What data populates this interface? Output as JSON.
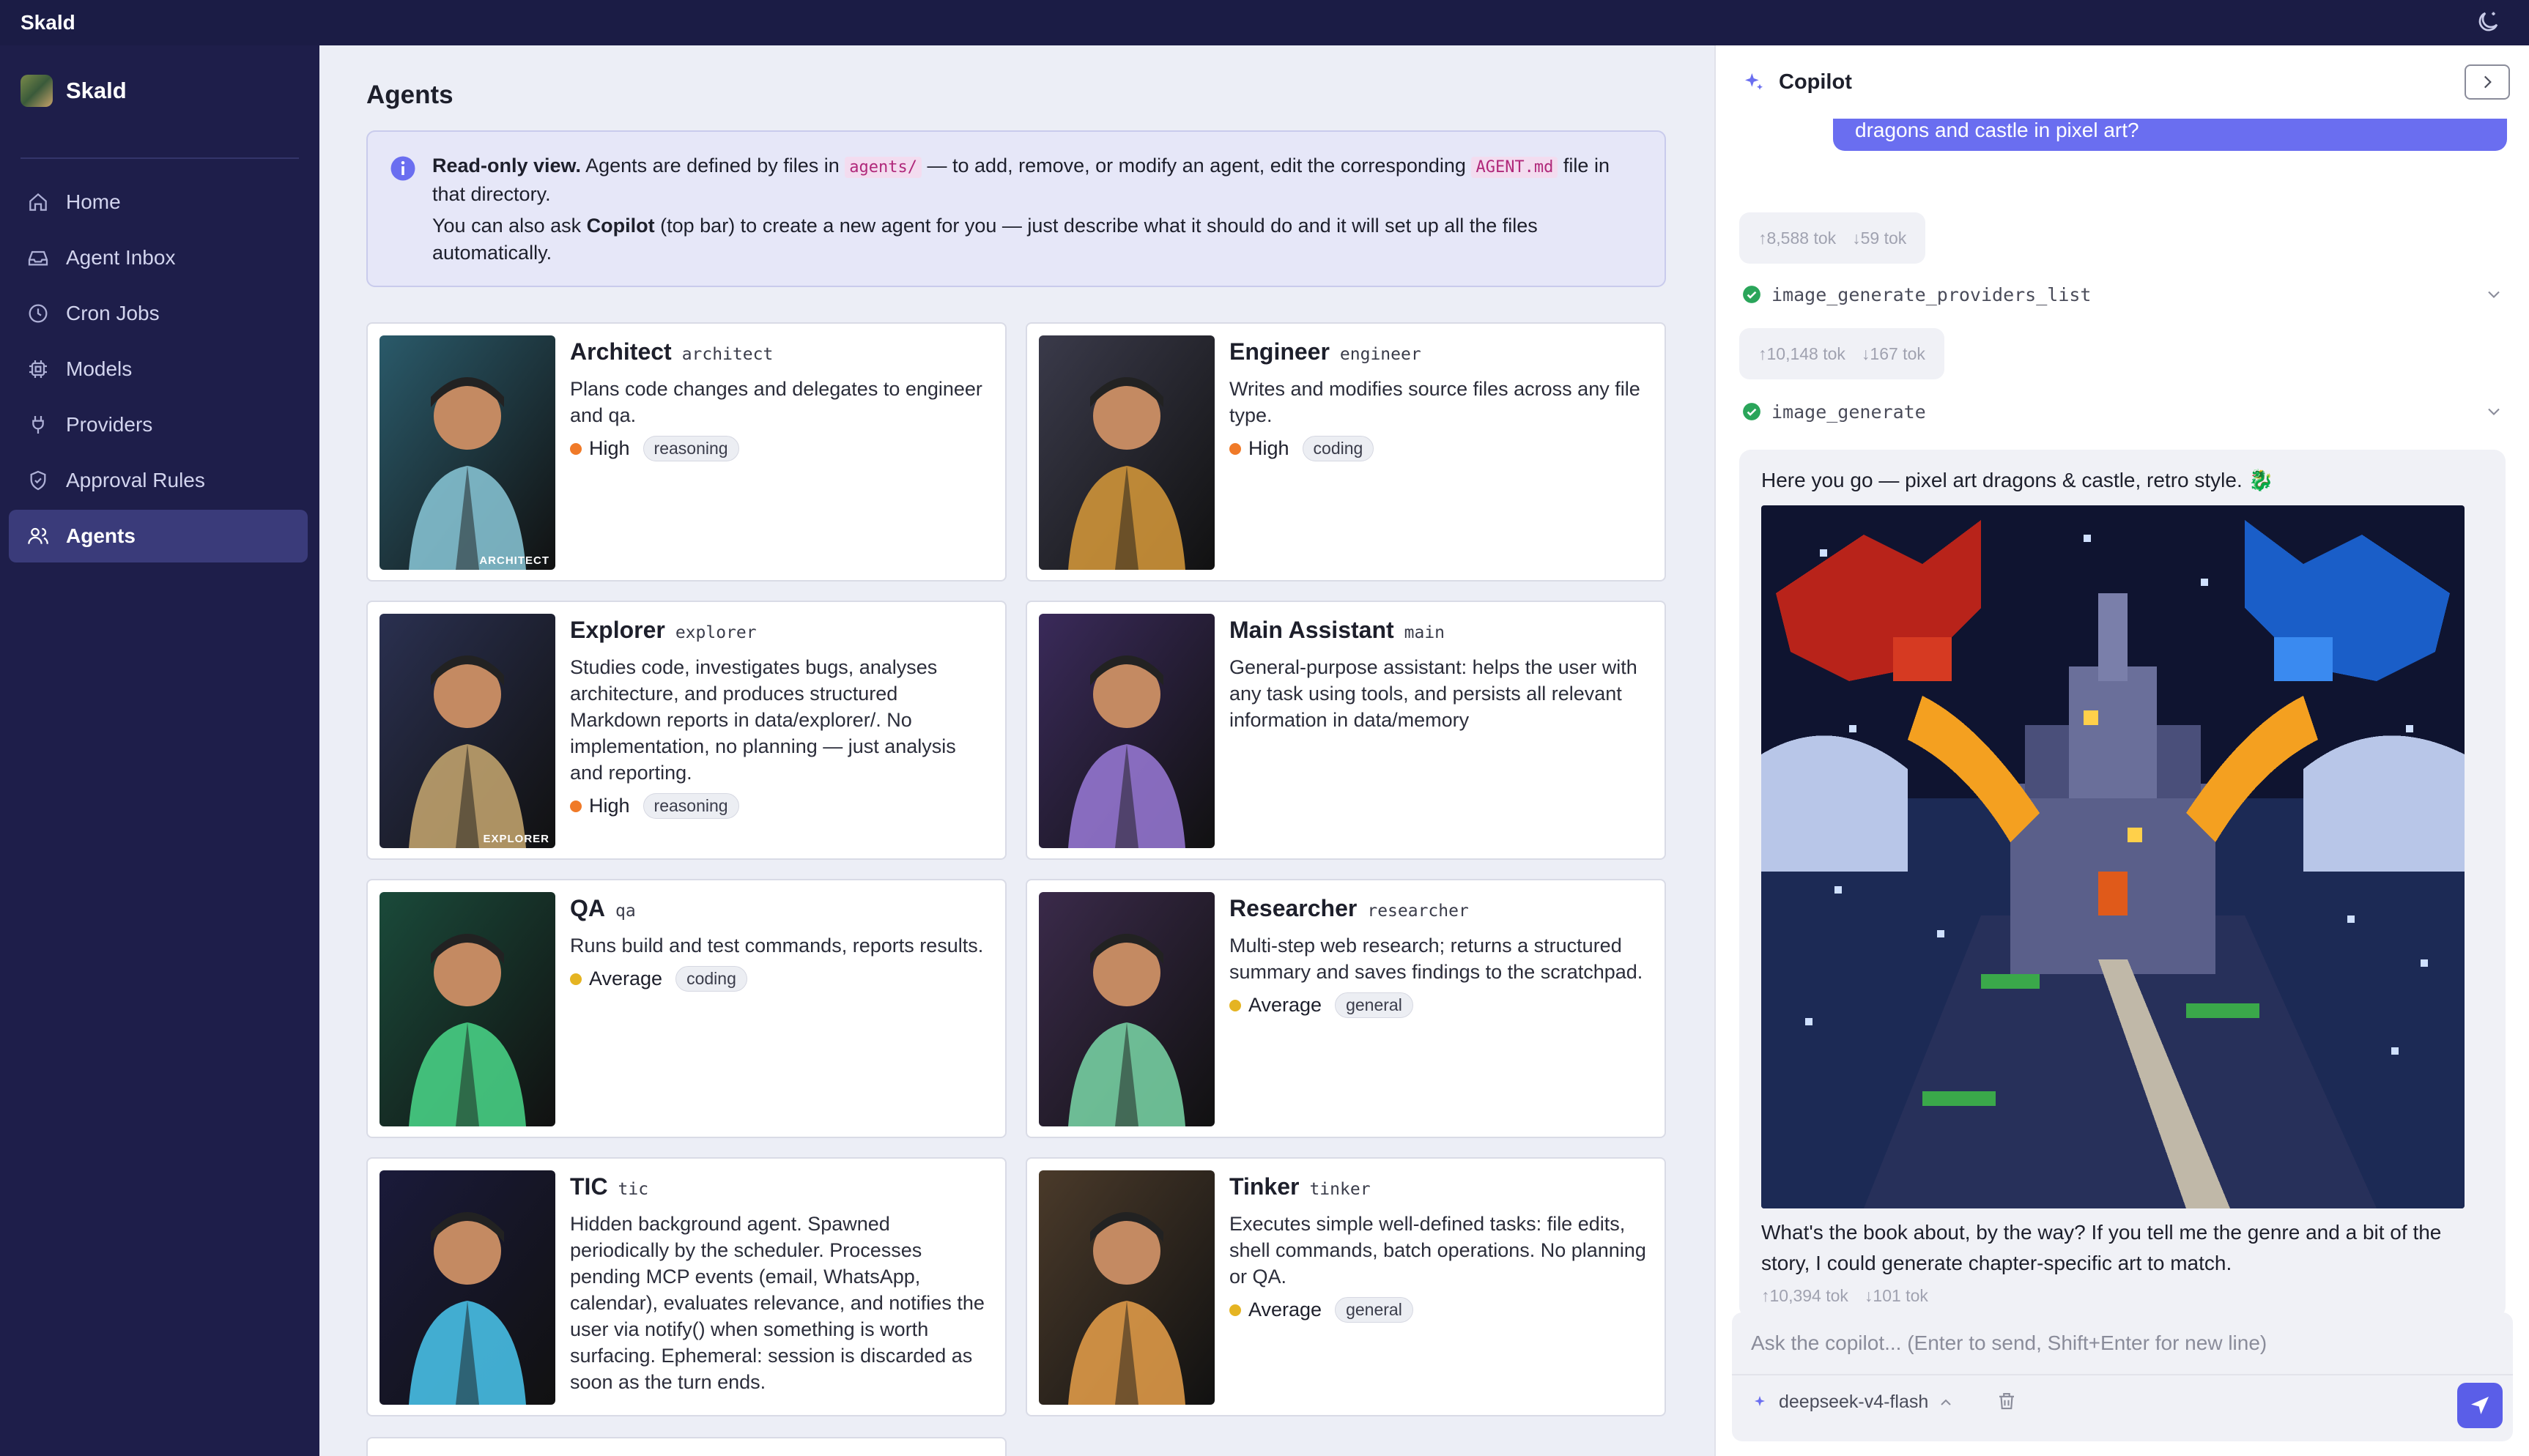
{
  "topbar": {
    "title": "Skald"
  },
  "sidebar": {
    "brand": "Skald",
    "items": [
      {
        "label": "Home",
        "icon": "home-icon"
      },
      {
        "label": "Agent Inbox",
        "icon": "inbox-icon"
      },
      {
        "label": "Cron Jobs",
        "icon": "clock-icon"
      },
      {
        "label": "Models",
        "icon": "chip-icon"
      },
      {
        "label": "Providers",
        "icon": "plug-icon"
      },
      {
        "label": "Approval Rules",
        "icon": "shield-icon"
      },
      {
        "label": "Agents",
        "icon": "users-icon",
        "active": true
      }
    ]
  },
  "main": {
    "title": "Agents",
    "notice": {
      "bold": "Read-only view.",
      "text1": " Agents are defined by files in ",
      "code1": "agents/",
      "text2": " — to add, remove, or modify an agent, edit the corresponding ",
      "code2": "AGENT.md",
      "text3": " file in that directory.",
      "line2a": "You can also ask ",
      "line2b": "Copilot",
      "line2c": " (top bar) to create a new agent for you — just describe what it should do and it will set up all the files automatically."
    },
    "agents": [
      {
        "name": "Architect",
        "id": "architect",
        "desc": "Plans code changes and delegates to engineer and qa.",
        "level": "High",
        "tag": "reasoning",
        "caption": "ARCHITECT"
      },
      {
        "name": "Engineer",
        "id": "engineer",
        "desc": "Writes and modifies source files across any file type.",
        "level": "High",
        "tag": "coding",
        "caption": ""
      },
      {
        "name": "Explorer",
        "id": "explorer",
        "desc": "Studies code, investigates bugs, analyses architecture, and produces structured Markdown reports in data/explorer/. No implementation, no planning — just analysis and reporting.",
        "level": "High",
        "tag": "reasoning",
        "caption": "EXPLORER"
      },
      {
        "name": "Main Assistant",
        "id": "main",
        "desc": "General-purpose assistant: helps the user with any task using tools, and persists all relevant information in data/memory",
        "level": "",
        "tag": "",
        "caption": ""
      },
      {
        "name": "QA",
        "id": "qa",
        "desc": "Runs build and test commands, reports results.",
        "level": "Average",
        "tag": "coding",
        "caption": ""
      },
      {
        "name": "Researcher",
        "id": "researcher",
        "desc": "Multi-step web research; returns a structured summary and saves findings to the scratchpad.",
        "level": "Average",
        "tag": "general",
        "caption": ""
      },
      {
        "name": "TIC",
        "id": "tic",
        "desc": "Hidden background agent. Spawned periodically by the scheduler. Processes pending MCP events (email, WhatsApp, calendar), evaluates relevance, and notifies the user via notify() when something is worth surfacing. Ephemeral: session is discarded as soon as the turn ends.",
        "level": "",
        "tag": "",
        "caption": ""
      },
      {
        "name": "Tinker",
        "id": "tinker",
        "desc": "Executes simple well-defined tasks: file edits, shell commands, batch operations. No planning or QA.",
        "level": "Average",
        "tag": "general",
        "caption": ""
      }
    ],
    "level_colors": {
      "High": "#f07a28",
      "Average": "#e5b422"
    }
  },
  "copilot": {
    "title": "Copilot",
    "user_message_tail": "dragons and castle in pixel art?",
    "tok1": {
      "in": "↑8,588 tok",
      "out": "↓59 tok"
    },
    "tool1": "image_generate_providers_list",
    "tok2": {
      "in": "↑10,148 tok",
      "out": "↓167 tok"
    },
    "tool2": "image_generate",
    "reply1": "Here you go — pixel art dragons & castle, retro style. 🐉",
    "reply2": "What's the book about, by the way? If you tell me the genre and a bit of the story, I could generate chapter-specific art to match.",
    "tok3": {
      "in": "↑10,394 tok",
      "out": "↓101 tok"
    },
    "input_placeholder": "Ask the copilot... (Enter to send, Shift+Enter for new line)",
    "model": "deepseek-v4-flash"
  },
  "colors": {
    "accent": "#5a5ee8",
    "sidebar": "#1e1e4a",
    "success": "#2aa55a"
  }
}
